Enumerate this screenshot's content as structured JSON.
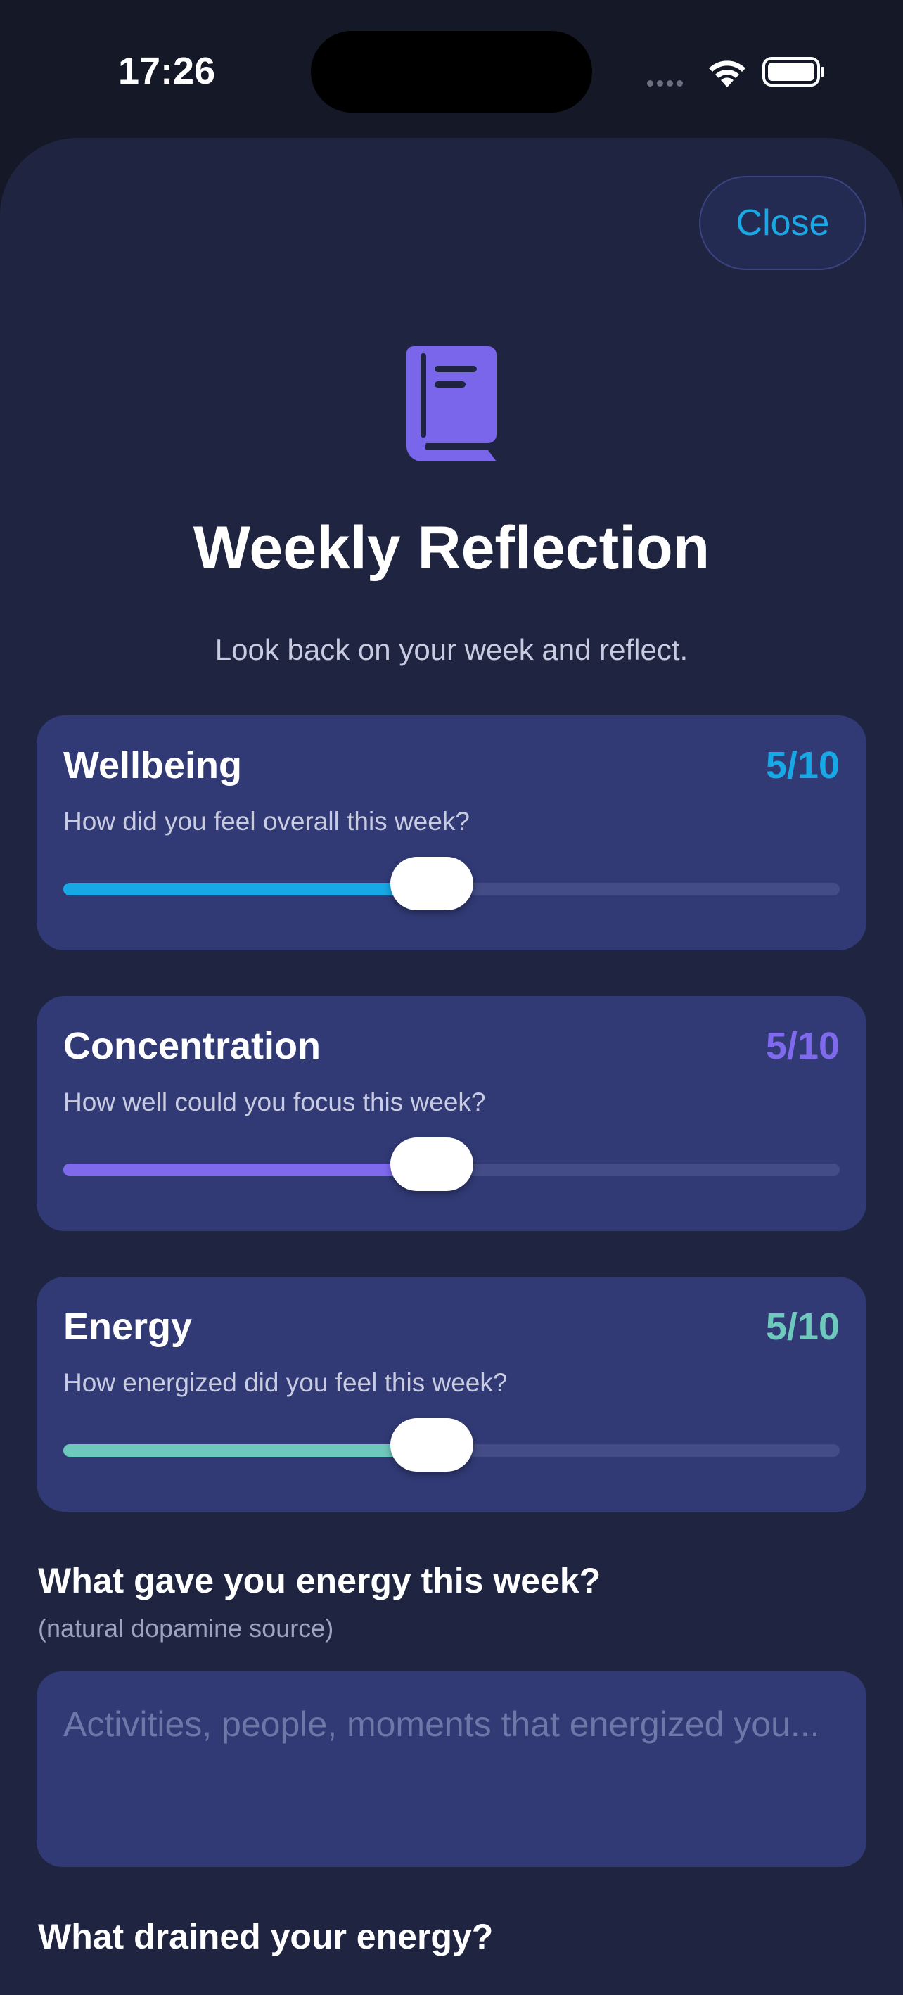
{
  "status_bar": {
    "time": "17:26"
  },
  "header": {
    "close_label": "Close",
    "icon": "book-icon",
    "title": "Weekly Reflection",
    "subtitle": "Look back on your week and reflect."
  },
  "ratings": [
    {
      "title": "Wellbeing",
      "score": "5/10",
      "question": "How did you feel overall this week?",
      "value": 5,
      "max": 10,
      "color": "#16a9e5"
    },
    {
      "title": "Concentration",
      "score": "5/10",
      "question": "How well could you focus this week?",
      "value": 5,
      "max": 10,
      "color": "#7f6aee"
    },
    {
      "title": "Energy",
      "score": "5/10",
      "question": "How energized did you feel this week?",
      "value": 5,
      "max": 10,
      "color": "#6ec9bd"
    }
  ],
  "energy_gain": {
    "label": "What gave you energy this week?",
    "sublabel": "(natural dopamine source)",
    "placeholder": "Activities, people, moments that energized you...",
    "value": ""
  },
  "energy_drain": {
    "label": "What drained your energy?"
  },
  "colors": {
    "background": "#141827",
    "sheet": "#1f2440",
    "card": "#313a75",
    "accent_blue": "#16a9e5",
    "accent_purple": "#7f6aee",
    "accent_teal": "#6ec9bd"
  }
}
